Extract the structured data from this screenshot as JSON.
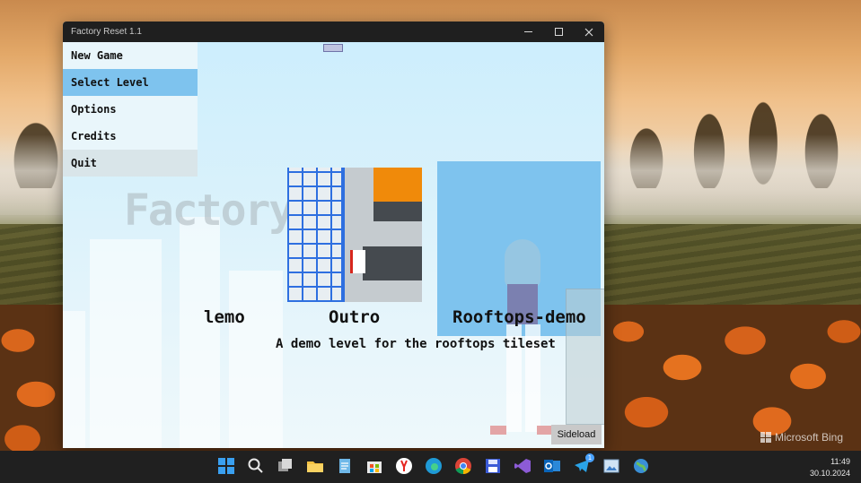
{
  "window": {
    "title": "Factory Reset 1.1"
  },
  "menu": {
    "items": [
      {
        "label": "New Game"
      },
      {
        "label": "Select Level"
      },
      {
        "label": "Options"
      },
      {
        "label": "Credits"
      },
      {
        "label": "Quit"
      }
    ],
    "selected": "Select Level"
  },
  "background": {
    "logo_text": "Factory"
  },
  "levels": {
    "cards": [
      {
        "title": "lemo"
      },
      {
        "title": "Outro"
      },
      {
        "title": "Rooftops-demo"
      }
    ],
    "selected": "Rooftops-demo",
    "description": "A demo level for the rooftops tileset"
  },
  "sideload": {
    "label": "Sideload"
  },
  "wallpaper": {
    "watermark": "Microsoft Bing"
  },
  "taskbar": {
    "icons": [
      "windows-start-icon",
      "search-icon",
      "task-view-icon",
      "file-explorer-icon",
      "notepad-icon",
      "microsoft-store-icon",
      "yandex-browser-icon",
      "edge-icon",
      "chrome-icon",
      "save-disk-icon",
      "visual-studio-icon",
      "outlook-icon",
      "telegram-icon",
      "photo-viewer-icon",
      "globe-app-icon"
    ],
    "telegram_badge": "1",
    "time": "11:49",
    "date": "30.10.2024"
  },
  "colors": {
    "menu_selected": "#7ec3ee",
    "level_selected": "#7ec3ee",
    "taskbar": "#202020",
    "titlebar": "#1f1f1f"
  }
}
